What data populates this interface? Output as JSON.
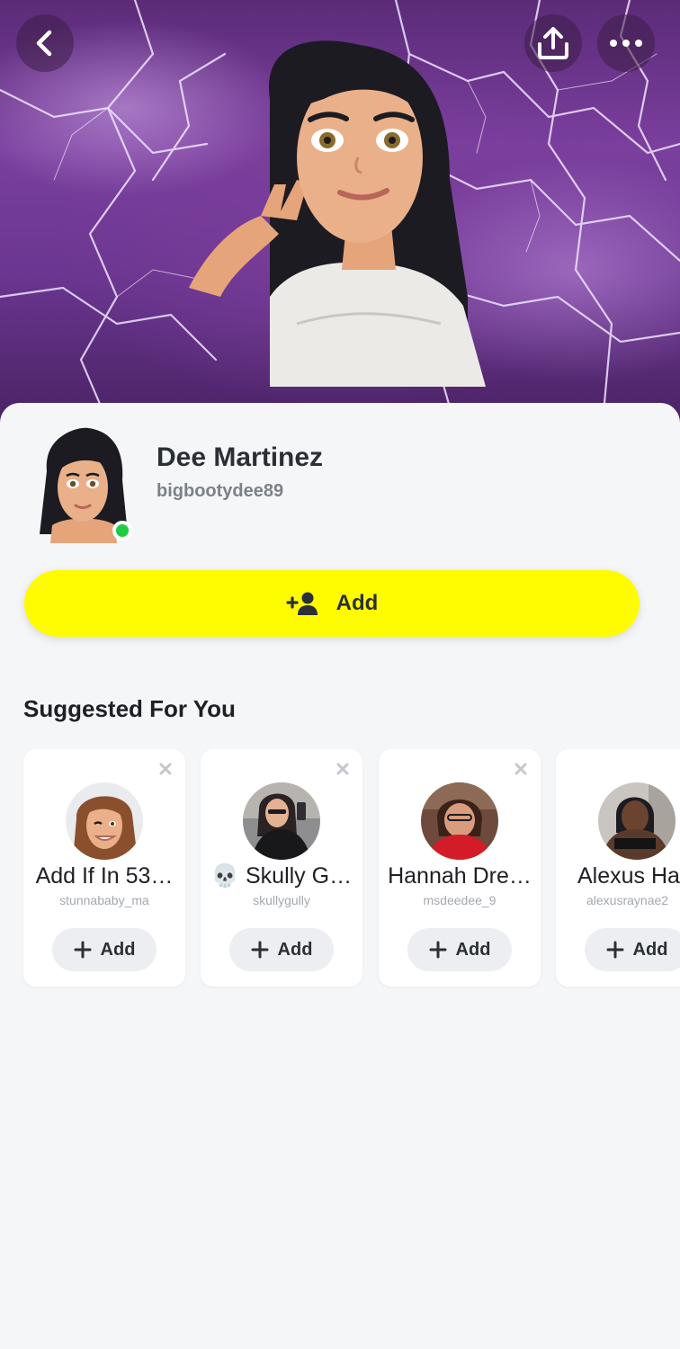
{
  "header": {
    "back_icon": "chevron-left-icon",
    "share_icon": "upload-share-icon",
    "more_icon": "more-dots-icon"
  },
  "profile": {
    "display_name": "Dee Martinez",
    "username": "bigbootydee89",
    "status_color": "#1fcb3f"
  },
  "add_button": {
    "label": "Add",
    "icon": "add-friend-icon",
    "color": "#fffc00"
  },
  "suggested": {
    "title": "Suggested For You",
    "cards": [
      {
        "name": "Add If In 53…",
        "username": "stunnababy_ma",
        "add_label": "Add"
      },
      {
        "name": "💀 Skully G…",
        "username": "skullygully",
        "add_label": "Add"
      },
      {
        "name": "Hannah Dre…",
        "username": "msdeedee_9",
        "add_label": "Add"
      },
      {
        "name": "Alexus Ha",
        "username": "alexusraynae2",
        "add_label": "Add"
      }
    ]
  }
}
